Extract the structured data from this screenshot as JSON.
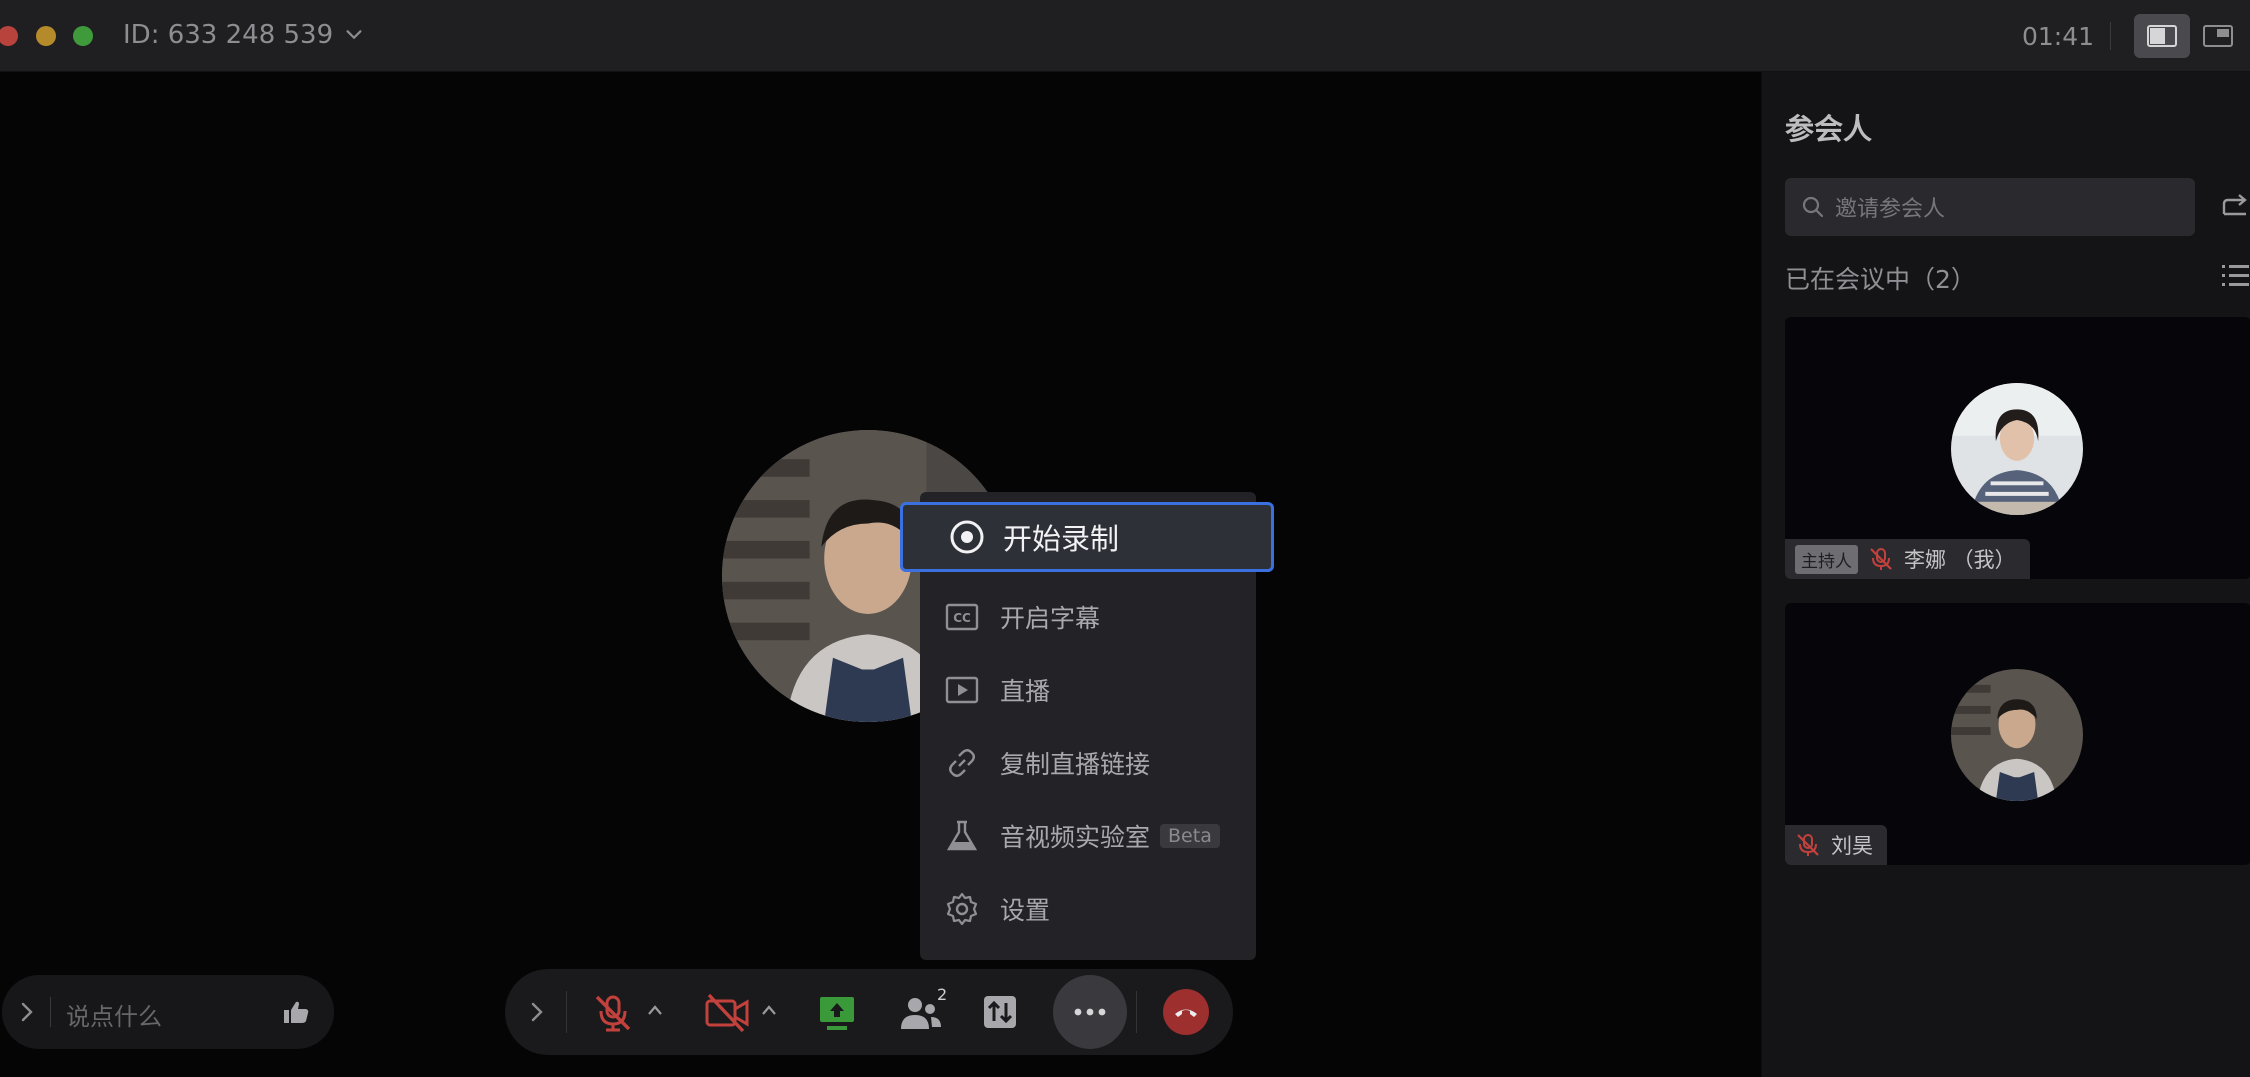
{
  "titlebar": {
    "meeting_id": "ID: 633 248 539",
    "timer": "01:41"
  },
  "participants_panel": {
    "title": "参会人",
    "invite_placeholder": "邀请参会人",
    "in_meeting_label": "已在会议中（2）",
    "participants": [
      {
        "name": "李娜 （我）",
        "host_badge": "主持人",
        "muted": true
      },
      {
        "name": "刘昊",
        "muted": true
      }
    ]
  },
  "chat": {
    "placeholder": "说点什么"
  },
  "toolbar": {
    "participants_count": "2"
  },
  "more_menu": {
    "items": [
      {
        "label": "开始录制",
        "icon": "record-icon",
        "highlighted": true
      },
      {
        "label": "开启字幕",
        "icon": "cc-icon"
      },
      {
        "label": "直播",
        "icon": "play-icon"
      },
      {
        "label": "复制直播链接",
        "icon": "link-icon"
      },
      {
        "label": "音视频实验室",
        "icon": "flask-icon",
        "tag": "Beta"
      },
      {
        "label": "设置",
        "icon": "gear-icon"
      }
    ]
  },
  "colors": {
    "accent_blue": "#3b70e0",
    "mute_red": "#c2413c",
    "end_call_red": "#9d2f2f",
    "share_green": "#3a9a3a"
  }
}
